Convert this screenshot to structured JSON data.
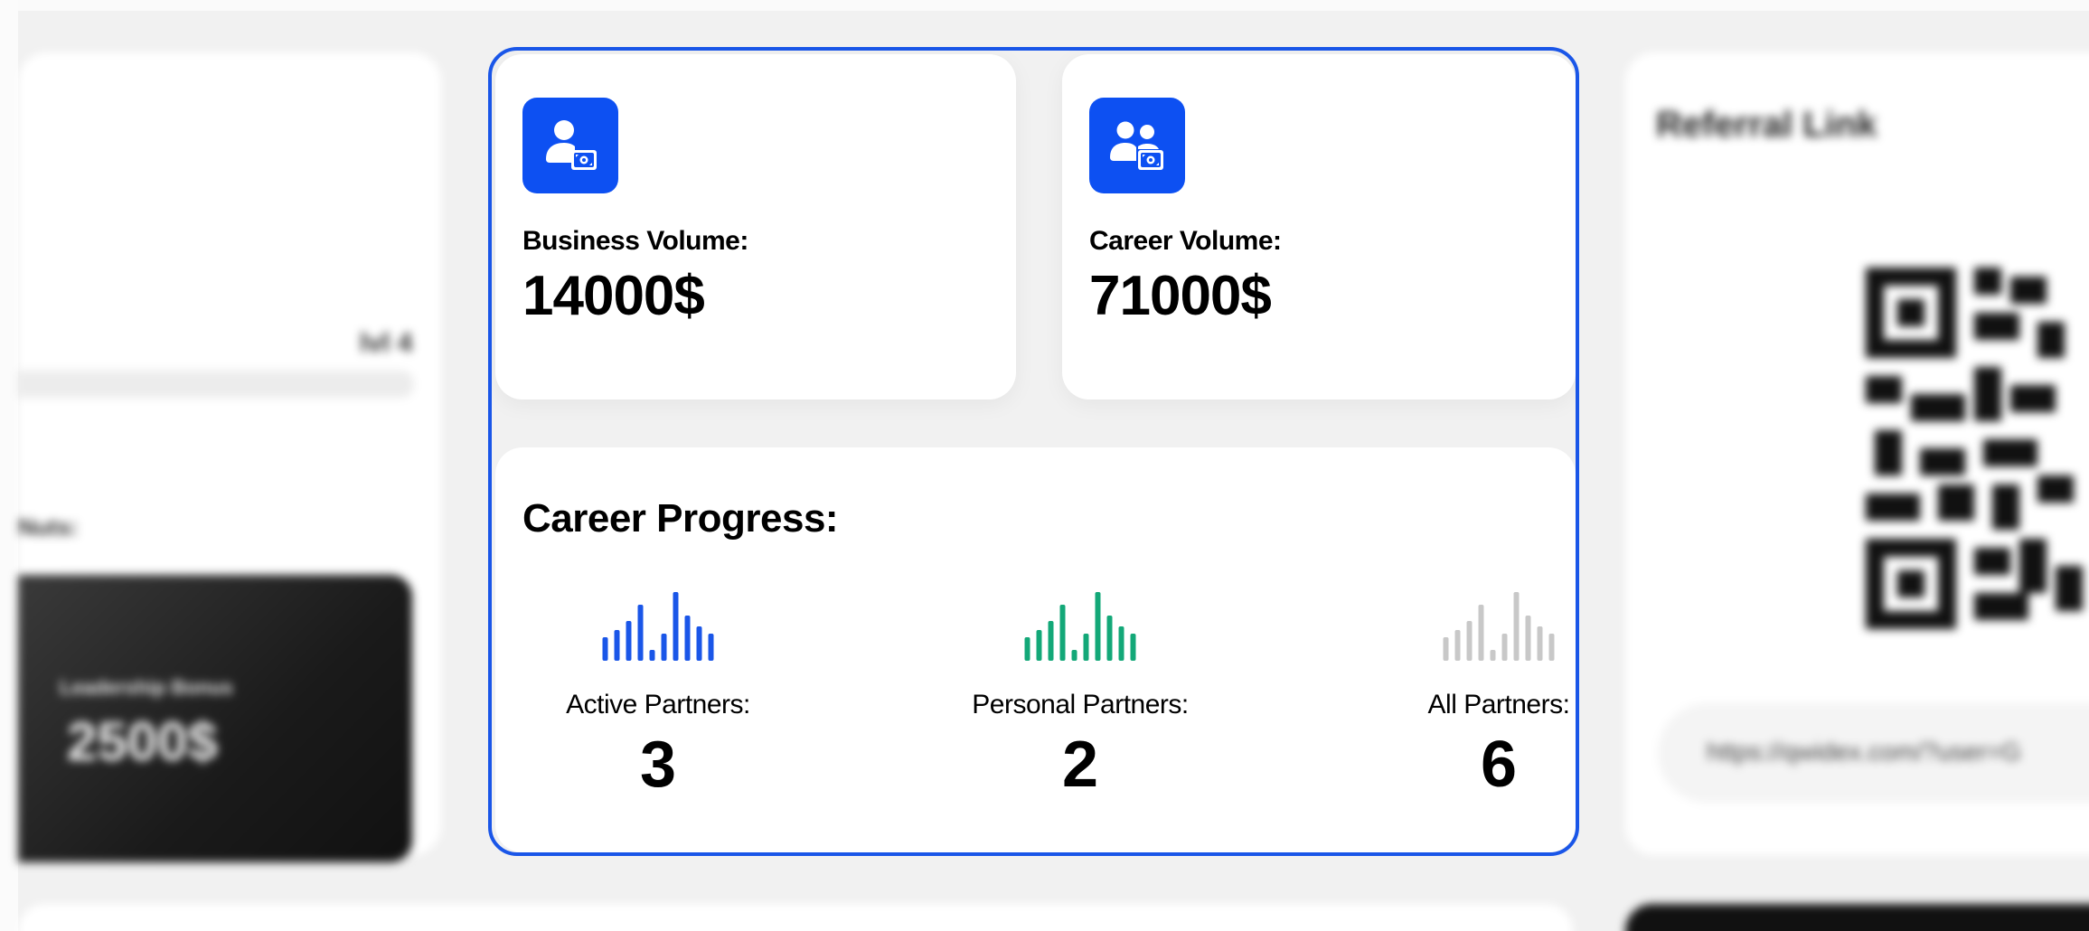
{
  "left_panel": {
    "level_text": "lvl 4",
    "section_label": "Nuts:",
    "bonus_label": "Leadership Bonus",
    "bonus_value": "2500$"
  },
  "business_volume": {
    "label": "Business Volume:",
    "value": "14000$",
    "icon": "user-money-icon"
  },
  "career_volume": {
    "label": "Career Volume:",
    "value": "71000$",
    "icon": "users-money-icon"
  },
  "career_progress": {
    "title": "Career Progress:",
    "stats": [
      {
        "label": "Active Partners:",
        "value": "3",
        "color": "#1a56e8"
      },
      {
        "label": "Personal Partners:",
        "value": "2",
        "color": "#13a878"
      },
      {
        "label": "All Partners:",
        "value": "6",
        "color": "#c8c8c8"
      }
    ]
  },
  "referral": {
    "title": "Referral Link",
    "link": "https://qwidex.com/?user=G"
  },
  "colors": {
    "accent": "#1a56e8",
    "icon_bg": "#0d50f2",
    "green": "#13a878",
    "gray": "#c8c8c8"
  }
}
